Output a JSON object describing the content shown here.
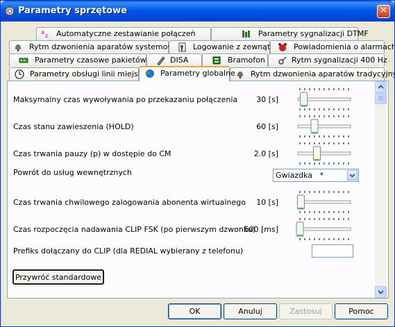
{
  "window": {
    "title": "Parametry sprzętowe",
    "close_glyph": "✕",
    "icon": "settings-gear-icon"
  },
  "tabs": {
    "row1": [
      {
        "label": "Automatyczne zestawianie połączeń",
        "icon": "az-sort-icon"
      },
      {
        "label": "Parametry sygnalizacji DTMF",
        "icon": "dtmf-bars-icon"
      }
    ],
    "row2": [
      {
        "label": "Rytm dzwonienia aparatów systemowych",
        "icon": "bells-icon"
      },
      {
        "label": "Logowanie z zewnątrz",
        "icon": "key-login-icon"
      },
      {
        "label": "Powiadomienia o alarmach",
        "icon": "alarm-icon"
      }
    ],
    "row3": [
      {
        "label": "Parametry czasowe pakietów",
        "icon": "packet-icon"
      },
      {
        "label": "DISA",
        "icon": "disa-icon"
      },
      {
        "label": "Bramofon",
        "icon": "intercom-icon"
      },
      {
        "label": "Rytm sygnalizacji 400 Hz",
        "icon": "signal-icon"
      }
    ],
    "row4": [
      {
        "label": "Parametry obsługi linii miejskich",
        "icon": "clock-icon"
      },
      {
        "label": "Parametry globalne",
        "icon": "globe-icon",
        "active": true
      },
      {
        "label": "Rytm dzwonienia aparatów tradycyjnych",
        "icon": "bells-icon"
      }
    ]
  },
  "settings": {
    "max_call_time": {
      "label": "Maksymalny czas wywoływania po przekazaniu połączenia",
      "value": "30 [s]",
      "slider_level": 0.08
    },
    "hold_time": {
      "label": "Czas stanu zawieszenia (HOLD)",
      "value": "60 [s]",
      "slider_level": 0.3
    },
    "pause_time": {
      "label": "Czas trwania pauzy (p) w dostępie do CM",
      "value": "2.0 [s]",
      "slider_level": 0.35
    },
    "internal_return": {
      "label": "Powrót do usług wewnętrznych",
      "selected": "Gwiazdka   *"
    },
    "virtual_login_time": {
      "label": "Czas trwania chwilowego zalogowania abonenta wirtualnego",
      "value": "10 [s]",
      "slider_level": 0.02
    },
    "clip_fsk_time": {
      "label": "Czas rozpoczęcia nadawania CLIP FSK (po pierwszym dzwonku)",
      "value": "500 [ms]",
      "slider_level": 0.0
    },
    "clip_prefix": {
      "label": "Prefiks dołączany do CLIP (dla REDIAL wybierany z telefonu)",
      "value": ""
    }
  },
  "buttons": {
    "restore_defaults": "Przywróć standardowe",
    "ok": "OK",
    "cancel": "Anuluj",
    "apply": "Zastosuj",
    "help": "Pomoc"
  },
  "colors": {
    "titlebar": "#0054e3",
    "active_tab_accent": "#e8a53c",
    "dialog_bg": "#ece9d8"
  }
}
